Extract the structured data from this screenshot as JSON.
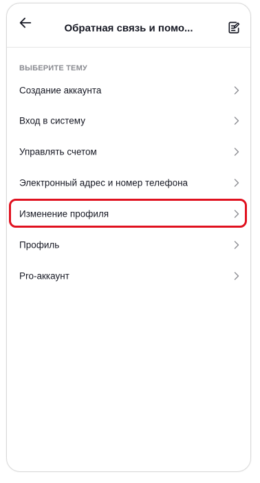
{
  "header": {
    "title": "Обратная связь и помо...",
    "back_icon": "arrow-left-icon",
    "edit_icon": "edit-note-icon"
  },
  "section": {
    "label": "ВЫБЕРИТЕ ТЕМУ"
  },
  "topics": [
    {
      "label": "Создание аккаунта"
    },
    {
      "label": "Вход в систему"
    },
    {
      "label": "Управлять счетом"
    },
    {
      "label": "Электронный адрес и номер телефона"
    },
    {
      "label": "Изменение профиля"
    },
    {
      "label": "Профиль"
    },
    {
      "label": "Pro-аккаунт"
    }
  ],
  "colors": {
    "highlight": "#e0101e",
    "text": "#161823",
    "muted": "#8a8b91",
    "chevron": "#8a8b91"
  }
}
